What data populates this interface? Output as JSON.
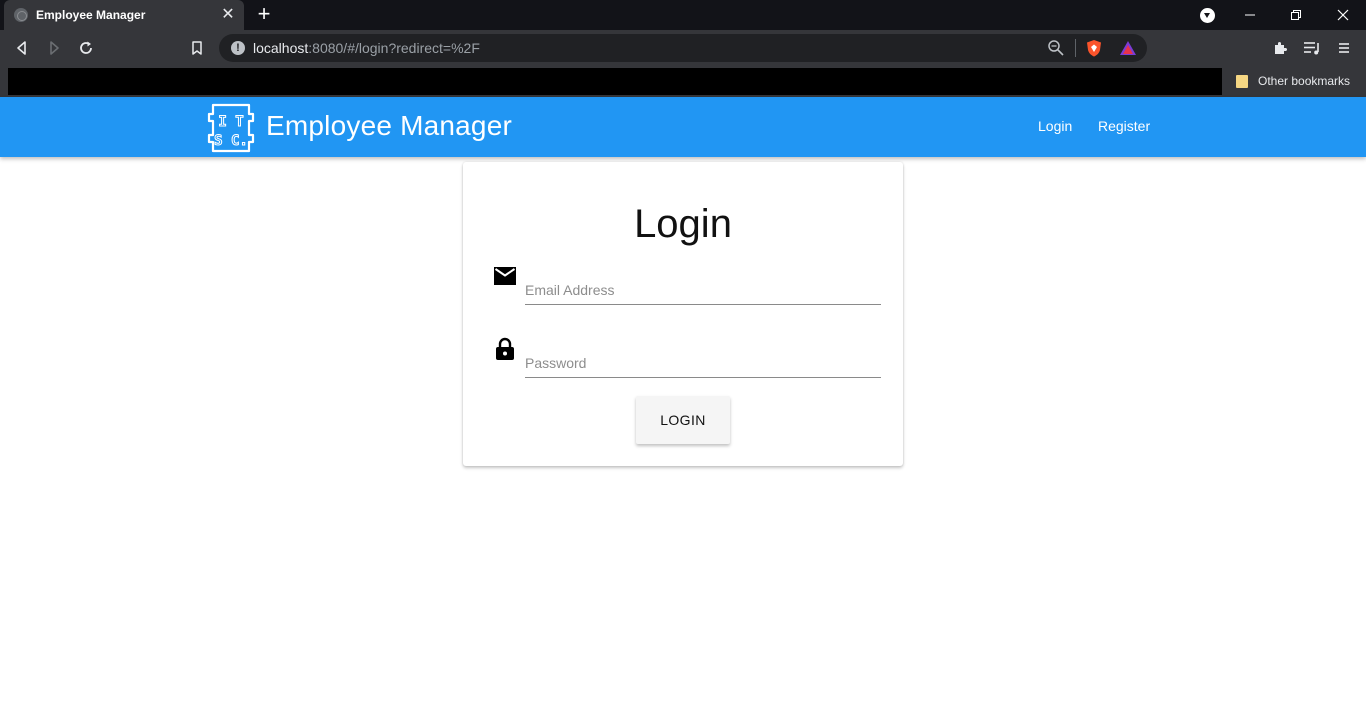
{
  "browser": {
    "tab_title": "Employee Manager",
    "tab_close": "✕",
    "new_tab": "+",
    "url_host": "localhost",
    "url_rest": ":8080/#/login?redirect=%2F",
    "url_info": "!",
    "other_bookmarks": "Other bookmarks"
  },
  "app": {
    "brand": "Employee Manager",
    "logo_text": [
      "I T",
      "S C."
    ],
    "nav": {
      "login": "Login",
      "register": "Register"
    }
  },
  "login": {
    "title": "Login",
    "email_placeholder": "Email Address",
    "password_placeholder": "Password",
    "button_label": "LOGIN"
  },
  "colors": {
    "appbar": "#2196f3",
    "chrome_dark": "#121318",
    "chrome_toolbar": "#35363a"
  }
}
